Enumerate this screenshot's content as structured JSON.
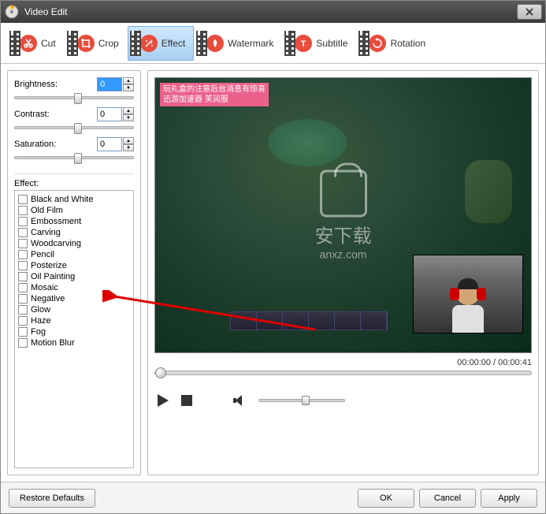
{
  "window": {
    "title": "Video Edit"
  },
  "toolbar": {
    "items": [
      {
        "label": "Cut",
        "color": "#e84c3d"
      },
      {
        "label": "Crop",
        "color": "#e84c3d"
      },
      {
        "label": "Effect",
        "color": "#e84c3d",
        "active": true
      },
      {
        "label": "Watermark",
        "color": "#e84c3d"
      },
      {
        "label": "Subtitle",
        "color": "#e84c3d"
      },
      {
        "label": "Rotation",
        "color": "#e84c3d"
      }
    ]
  },
  "adjust": {
    "brightness": {
      "label": "Brightness:",
      "value": "0",
      "pos": 50
    },
    "contrast": {
      "label": "Contrast:",
      "value": "0",
      "pos": 50
    },
    "saturation": {
      "label": "Saturation:",
      "value": "0",
      "pos": 50
    }
  },
  "effect": {
    "title": "Effect:",
    "items": [
      "Black and White",
      "Old Film",
      "Embossment",
      "Carving",
      "Woodcarving",
      "Pencil",
      "Posterize",
      "Oil Painting",
      "Mosaic",
      "Negative",
      "Glow",
      "Haze",
      "Fog",
      "Motion Blur"
    ]
  },
  "preview": {
    "overlay_line1": "玩礼盒的注意后台消息有惊喜",
    "overlay_line2": "迅游加速器 芙润服",
    "watermark_main": "安下载",
    "watermark_sub": "anxz.com"
  },
  "time": {
    "current": "00:00:00",
    "total": "00:00:41",
    "separator": " / "
  },
  "volume": {
    "pos": 50
  },
  "buttons": {
    "restore": "Restore Defaults",
    "ok": "OK",
    "cancel": "Cancel",
    "apply": "Apply"
  }
}
